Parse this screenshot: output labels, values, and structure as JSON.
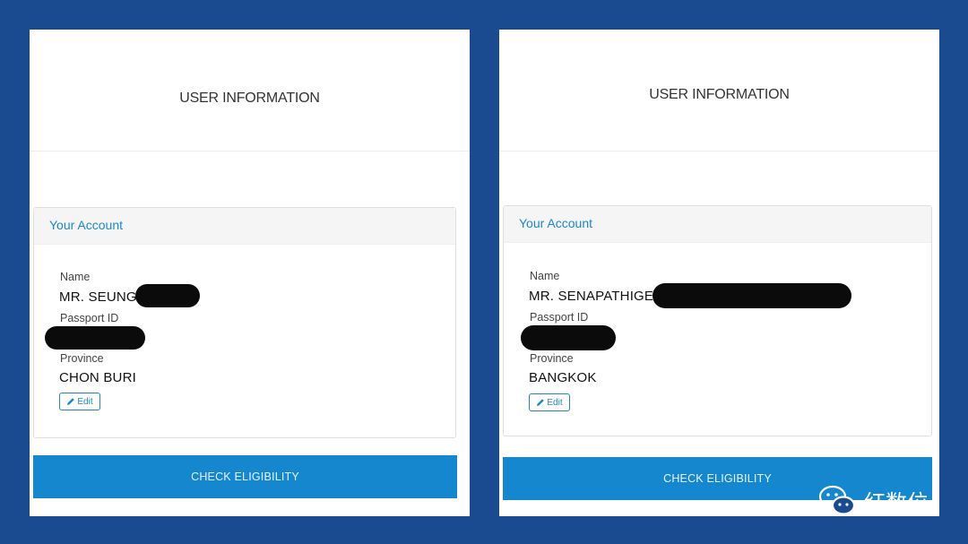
{
  "panels": [
    {
      "title": "USER INFORMATION",
      "card_title": "Your Account",
      "name_label": "Name",
      "name_value": "MR. SEUNG HO CHOI",
      "passport_label": "Passport ID",
      "province_label": "Province",
      "province_value": "CHON BURI",
      "edit_label": "Edit",
      "check_label": "CHECK ELIGIBILITY"
    },
    {
      "title": "USER INFORMATION",
      "card_title": "Your Account",
      "name_label": "Name",
      "name_value": "MR. SENAPATHIGE",
      "passport_label": "Passport ID",
      "province_label": "Province",
      "province_value": "BANGKOK",
      "edit_label": "Edit",
      "check_label": "CHECK ELIGIBILITY"
    }
  ],
  "watermark": {
    "text": "红数位",
    "icon": "wechat-icon"
  },
  "colors": {
    "background": "#1a4a8f",
    "accent": "#1f87c9",
    "button": "#1587cf"
  }
}
